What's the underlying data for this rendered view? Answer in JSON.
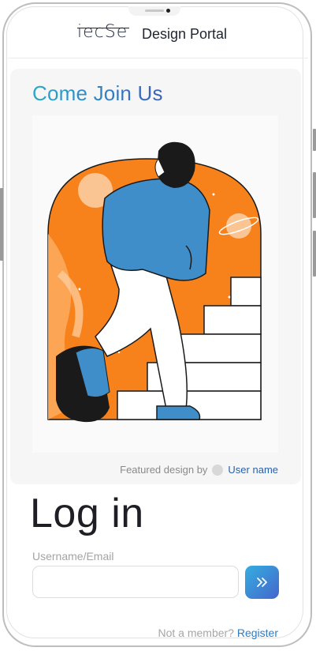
{
  "header": {
    "logo_text": "iecSe",
    "portal_title": "Design Portal"
  },
  "card": {
    "title": "Come Join Us",
    "featured_prefix": "Featured design by",
    "featured_user": "User name"
  },
  "login": {
    "title": "Log in",
    "username_label": "Username/Email",
    "username_value": "",
    "submit_icon": "double-chevron-right-icon",
    "register_prompt": "Not a member?",
    "register_link": "Register"
  },
  "colors": {
    "title_gradient_start": "#2aa9c9",
    "title_gradient_end": "#3b5fbf",
    "button_gradient_start": "#35aee0",
    "button_gradient_end": "#4466cc",
    "art_orange": "#f7821b",
    "art_blue": "#3f8ec9"
  }
}
